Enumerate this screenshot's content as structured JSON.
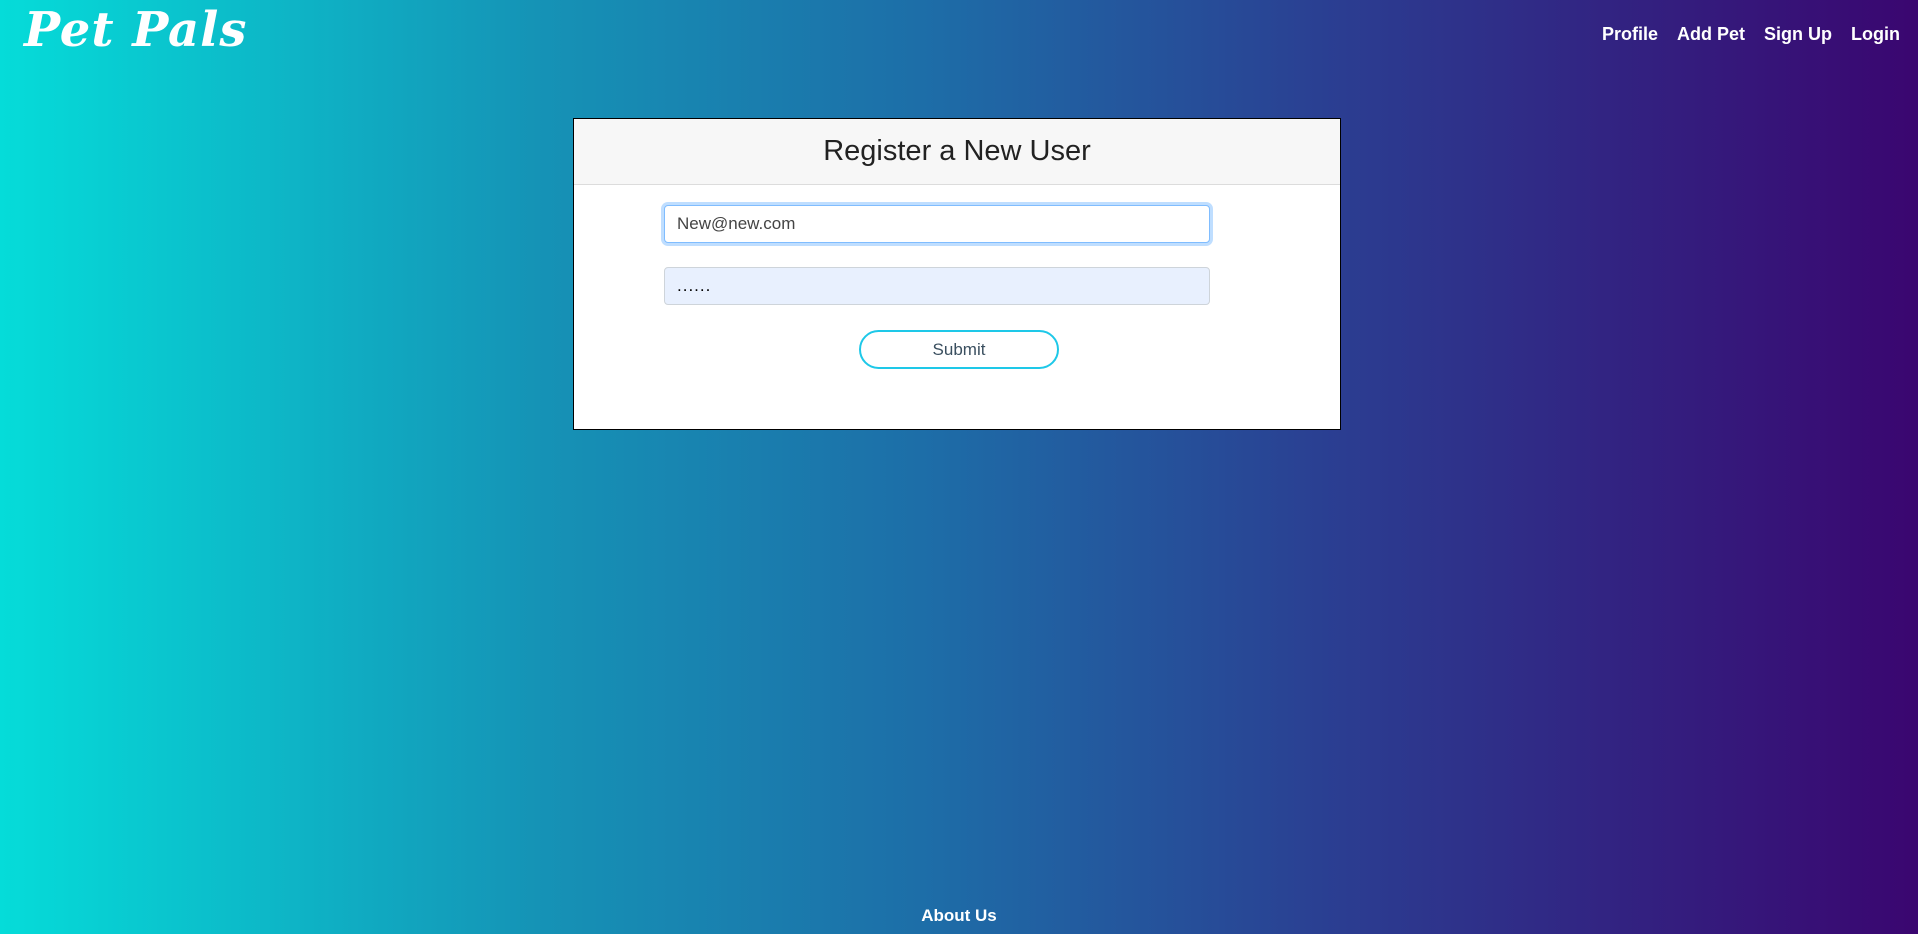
{
  "header": {
    "brand": "Pet Pals",
    "nav": [
      {
        "label": "Profile"
      },
      {
        "label": "Add Pet"
      },
      {
        "label": "Sign Up"
      },
      {
        "label": "Login"
      }
    ]
  },
  "form": {
    "title": "Register a New User",
    "email_value": "New@new.com",
    "password_value": "......",
    "submit_label": "Submit"
  },
  "footer": {
    "about_label": "About Us"
  },
  "colors": {
    "gradient_start": "#05dcd9",
    "gradient_end": "#3a0670",
    "button_border": "#1ec8e8"
  }
}
